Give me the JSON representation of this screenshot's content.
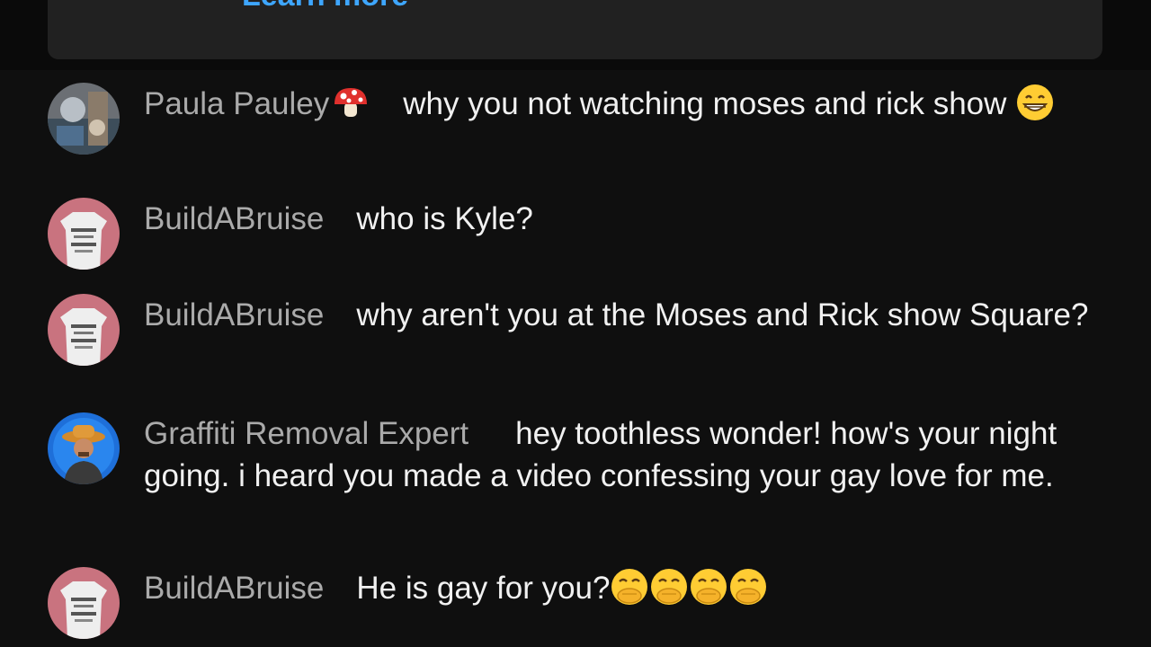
{
  "banner": {
    "link_text": "Learn more"
  },
  "messages": [
    {
      "author": "Paula Pauley",
      "author_badge": "mushroom-emoji",
      "text": "why you not watching moses and rick show",
      "trailing_emoji": [
        "grinning-face-emoji"
      ]
    },
    {
      "author": "BuildABruise",
      "text": "who is Kyle?"
    },
    {
      "author": "BuildABruise",
      "text": "why aren't you at the Moses and Rick show Square?"
    },
    {
      "author": "Graffiti Removal Expert",
      "text": "hey toothless wonder! how's your night going. i heard you made a video confessing your gay love for me."
    },
    {
      "author": "BuildABruise",
      "text": "He is gay for you?",
      "trailing_emoji": [
        "face-with-hand-over-mouth-emoji",
        "face-with-hand-over-mouth-emoji",
        "face-with-hand-over-mouth-emoji",
        "face-with-hand-over-mouth-emoji"
      ]
    }
  ],
  "colors": {
    "background": "#0f0f0f",
    "banner": "#212121",
    "link": "#3ea6ff",
    "author": "#aaaaaa",
    "message": "#f1f1f1"
  }
}
